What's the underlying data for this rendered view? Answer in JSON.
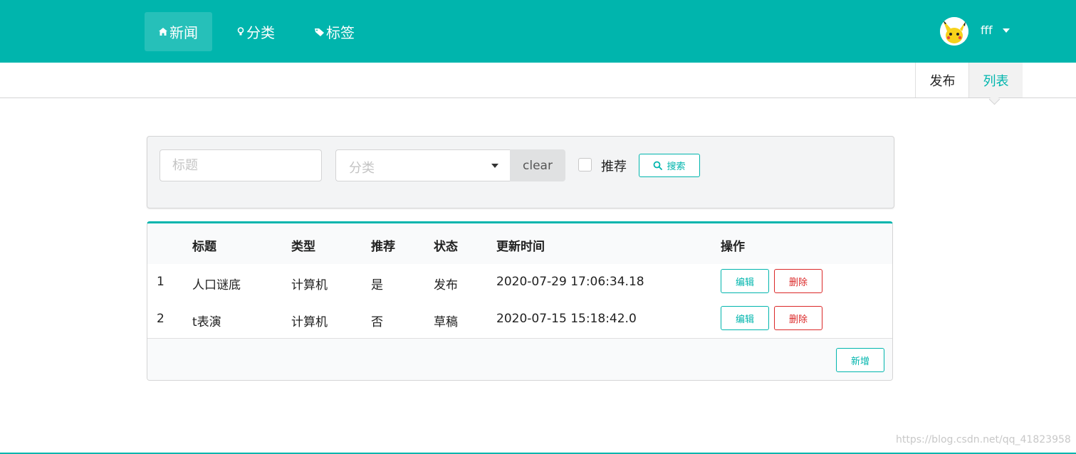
{
  "nav": {
    "items": [
      {
        "label": "新闻",
        "icon": "home-icon",
        "active": true
      },
      {
        "label": "分类",
        "icon": "idea-icon",
        "active": false
      },
      {
        "label": "标签",
        "icon": "tag-icon",
        "active": false
      }
    ],
    "user": {
      "name": "fff",
      "avatar": "pikachu-avatar"
    }
  },
  "submenu": {
    "publish": "发布",
    "list": "列表"
  },
  "search": {
    "title_placeholder": "标题",
    "category_placeholder": "分类",
    "clear": "clear",
    "recommend_label": "推荐",
    "search_button": "搜索"
  },
  "table": {
    "headers": [
      "",
      "标题",
      "类型",
      "推荐",
      "状态",
      "更新时间",
      "操作"
    ],
    "rows": [
      {
        "index": "1",
        "title": "人口谜底",
        "type": "计算机",
        "recommend": "是",
        "status": "发布",
        "updated": "2020-07-29 17:06:34.18"
      },
      {
        "index": "2",
        "title": "t表演",
        "type": "计算机",
        "recommend": "否",
        "status": "草稿",
        "updated": "2020-07-15 15:18:42.0"
      }
    ],
    "edit_label": "编辑",
    "delete_label": "删除",
    "add_label": "新增"
  },
  "watermark": "https://blog.csdn.net/qq_41823958",
  "colors": {
    "primary": "#00b5ad",
    "danger": "#db2828"
  }
}
